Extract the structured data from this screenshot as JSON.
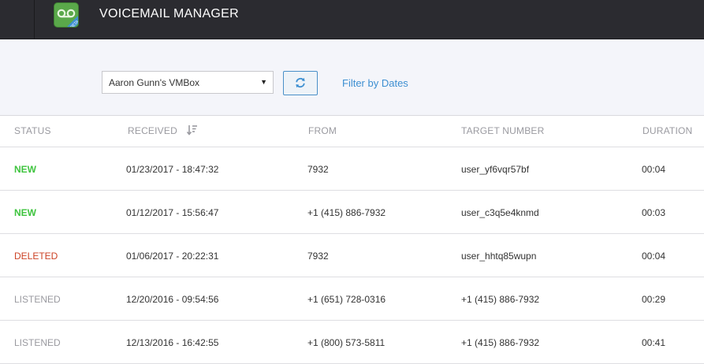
{
  "header": {
    "title": "VOICEMAIL MANAGER",
    "logo_icon": "voicemail-beta-icon",
    "logo_badge": "BETA"
  },
  "toolbar": {
    "vmbox_selected": "Aaron Gunn's VMBox",
    "refresh_icon": "refresh-icon",
    "filter_label": "Filter by Dates"
  },
  "table": {
    "columns": {
      "status": "STATUS",
      "received": "RECEIVED",
      "from": "FROM",
      "target": "TARGET NUMBER",
      "duration": "DURATION"
    },
    "rows": [
      {
        "status": "NEW",
        "received": "01/23/2017 - 18:47:32",
        "from": "7932",
        "target": "user_yf6vqr57bf",
        "duration": "00:04"
      },
      {
        "status": "NEW",
        "received": "01/12/2017 - 15:56:47",
        "from": "+1 (415) 886-7932",
        "target": "user_c3q5e4knmd",
        "duration": "00:03"
      },
      {
        "status": "DELETED",
        "received": "01/06/2017 - 20:22:31",
        "from": "7932",
        "target": "user_hhtq85wupn",
        "duration": "00:04"
      },
      {
        "status": "LISTENED",
        "received": "12/20/2016 - 09:54:56",
        "from": "+1 (651) 728-0316",
        "target": "+1 (415) 886-7932",
        "duration": "00:29"
      },
      {
        "status": "LISTENED",
        "received": "12/13/2016 - 16:42:55",
        "from": "+1 (800) 573-5811",
        "target": "+1 (415) 886-7932",
        "duration": "00:41"
      }
    ]
  },
  "colors": {
    "topbar": "#2b2b30",
    "toolbar_bg": "#f4f5fa",
    "accent_blue": "#3d8fd1",
    "status_new": "#3fc43f",
    "status_deleted": "#cc4326",
    "status_listened": "#9a9aa0"
  }
}
